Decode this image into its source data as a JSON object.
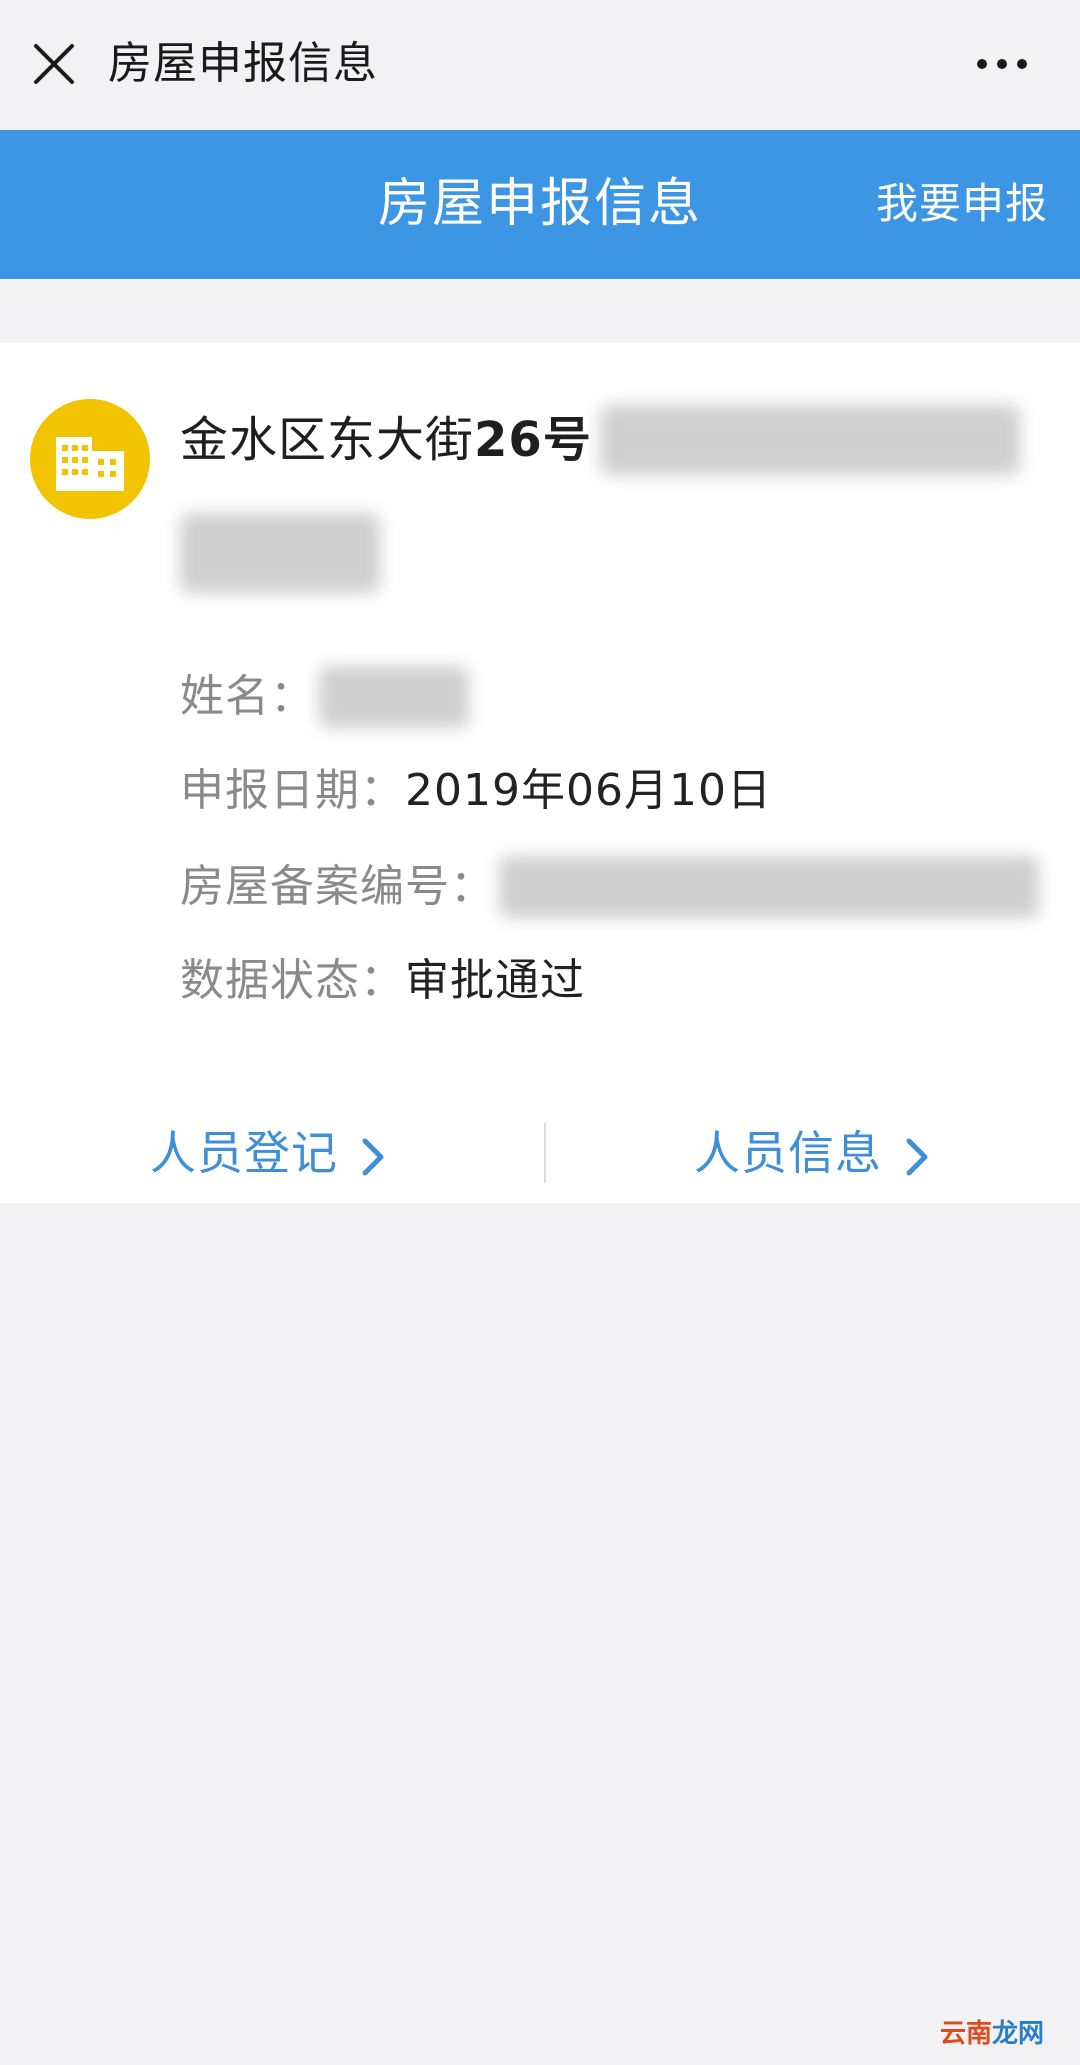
{
  "topbar": {
    "close_icon": "close-icon",
    "title": "房屋申报信息",
    "more_icon": "more-icon"
  },
  "header": {
    "title": "房屋申报信息",
    "action_label": "我要申报",
    "background_color": "#3d96e3"
  },
  "card": {
    "avatar_icon": "building-icon",
    "avatar_color": "#f2c400",
    "address_prefix": "金水区东大街",
    "address_number": "26号",
    "fields": [
      {
        "label": "姓名：",
        "value": ""
      },
      {
        "label": "申报日期：",
        "value": "2019年06月10日"
      },
      {
        "label": "房屋备案编号：",
        "value": ""
      },
      {
        "label": "数据状态：",
        "value": "审批通过"
      }
    ],
    "actions": [
      {
        "label": "人员登记"
      },
      {
        "label": "人员信息"
      }
    ],
    "link_color": "#3f8ed8"
  },
  "watermark": {
    "part1": "云南",
    "part2": "龙网"
  }
}
